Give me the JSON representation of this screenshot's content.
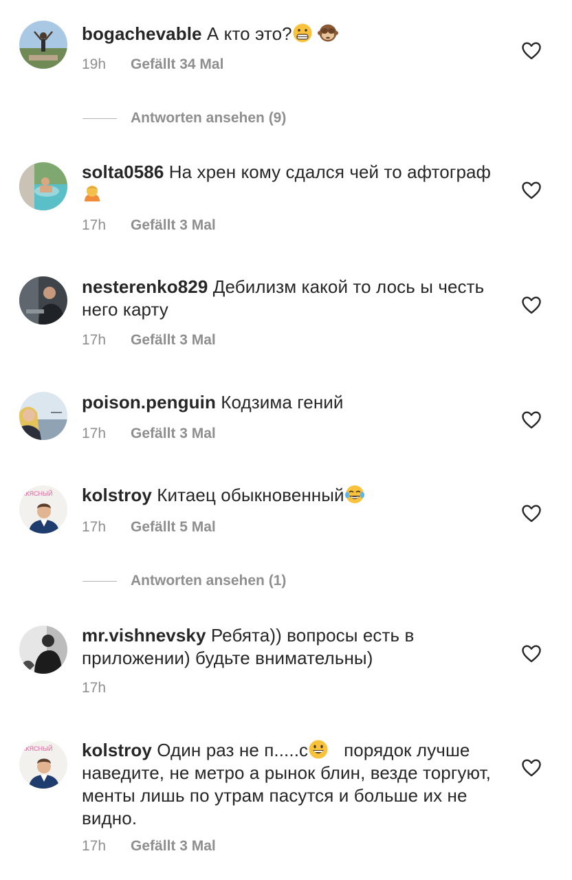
{
  "comments": [
    {
      "username": "bogachevable",
      "text": "А кто это?",
      "time": "19h",
      "likes": "Gefällt 34 Mal"
    },
    {
      "username": "solta0586",
      "text": "На хрен кому сдался чей то афтограф",
      "time": "17h",
      "likes": "Gefällt 3 Mal"
    },
    {
      "username": "nesterenko829",
      "text": "Дебилизм какой то лось ы честь него карту",
      "time": "17h",
      "likes": "Gefällt 3 Mal"
    },
    {
      "username": "poison.penguin",
      "text": "Кодзима гений",
      "time": "17h",
      "likes": "Gefällt 3 Mal"
    },
    {
      "username": "kolstroy",
      "text": "Китаец обыкновенный",
      "time": "17h",
      "likes": "Gefällt 5 Mal"
    },
    {
      "username": "mr.vishnevsky",
      "text": "Ребята)) вопросы есть в приложении) будьте внимательны)",
      "time": "17h"
    },
    {
      "username": "kolstroy",
      "text_part1": "Один раз не п.....с",
      "text_part2": "порядок лучше наведите, не метро а рынок блин, везде торгуют, менты лишь по утрам пасутся и больше их не видно.",
      "time": "17h",
      "likes": "Gefällt 3 Mal"
    }
  ],
  "replies": [
    {
      "label": "Antworten ansehen (9)"
    },
    {
      "label": "Antworten ansehen (1)"
    }
  ],
  "avatar_badge": "ККЯСНЫЙ",
  "icons": {
    "like": "heart-outline-icon",
    "emoji_grimace": "grimacing-face-emoji",
    "emoji_monkey": "see-no-evil-monkey-emoji",
    "emoji_facepalm": "person-facepalming-emoji",
    "emoji_laugh": "tears-of-joy-emoji",
    "emoji_grin": "grinning-face-emoji"
  },
  "colors": {
    "text": "#262626",
    "secondary": "#8e8e8e",
    "divider": "#b4b4b4"
  }
}
